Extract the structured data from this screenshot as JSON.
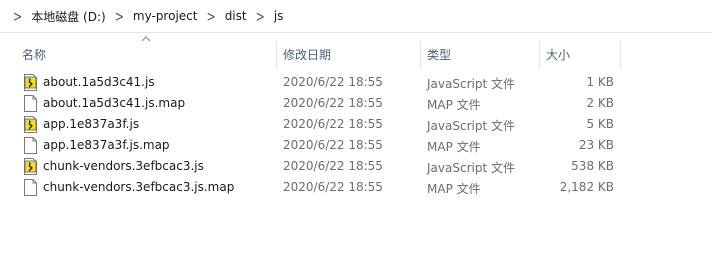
{
  "breadcrumb": {
    "items": [
      "本地磁盘 (D:)",
      "my-project",
      "dist",
      "js"
    ]
  },
  "columns": {
    "name": "名称",
    "date": "修改日期",
    "type": "类型",
    "size": "大小"
  },
  "files": [
    {
      "name": "about.1a5d3c41.js",
      "date": "2020/6/22 18:55",
      "type": "JavaScript 文件",
      "size": "1 KB",
      "icon": "js-file-icon"
    },
    {
      "name": "about.1a5d3c41.js.map",
      "date": "2020/6/22 18:55",
      "type": "MAP 文件",
      "size": "2 KB",
      "icon": "generic-file-icon"
    },
    {
      "name": "app.1e837a3f.js",
      "date": "2020/6/22 18:55",
      "type": "JavaScript 文件",
      "size": "5 KB",
      "icon": "js-file-icon"
    },
    {
      "name": "app.1e837a3f.js.map",
      "date": "2020/6/22 18:55",
      "type": "MAP 文件",
      "size": "23 KB",
      "icon": "generic-file-icon"
    },
    {
      "name": "chunk-vendors.3efbcac3.js",
      "date": "2020/6/22 18:55",
      "type": "JavaScript 文件",
      "size": "538 KB",
      "icon": "js-file-icon"
    },
    {
      "name": "chunk-vendors.3efbcac3.js.map",
      "date": "2020/6/22 18:55",
      "type": "MAP 文件",
      "size": "2,182 KB",
      "icon": "generic-file-icon"
    }
  ],
  "colors": {
    "header_text": "#4c607a",
    "secondary_text": "#6d6d6d"
  }
}
